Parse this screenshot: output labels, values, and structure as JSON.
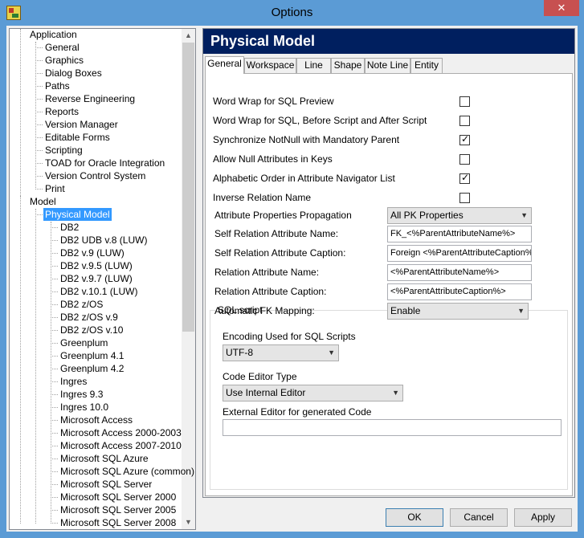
{
  "window": {
    "title": "Options",
    "close_glyph": "✕"
  },
  "tree": {
    "nodes": [
      {
        "label": "Application",
        "selected": false
      },
      {
        "label": "General",
        "selected": false
      },
      {
        "label": "Graphics",
        "selected": false
      },
      {
        "label": "Dialog Boxes",
        "selected": false
      },
      {
        "label": "Paths",
        "selected": false
      },
      {
        "label": "Reverse Engineering",
        "selected": false
      },
      {
        "label": "Reports",
        "selected": false
      },
      {
        "label": "Version Manager",
        "selected": false
      },
      {
        "label": "Editable Forms",
        "selected": false
      },
      {
        "label": "Scripting",
        "selected": false
      },
      {
        "label": "TOAD for Oracle Integration",
        "selected": false
      },
      {
        "label": "Version Control System",
        "selected": false
      },
      {
        "label": "Print",
        "selected": false
      },
      {
        "label": "Model",
        "selected": false
      },
      {
        "label": "Physical Model",
        "selected": true
      },
      {
        "label": "DB2",
        "selected": false
      },
      {
        "label": "DB2 UDB v.8 (LUW)",
        "selected": false
      },
      {
        "label": "DB2 v.9 (LUW)",
        "selected": false
      },
      {
        "label": "DB2 v.9.5 (LUW)",
        "selected": false
      },
      {
        "label": "DB2 v.9.7 (LUW)",
        "selected": false
      },
      {
        "label": "DB2 v.10.1 (LUW)",
        "selected": false
      },
      {
        "label": "DB2 z/OS",
        "selected": false
      },
      {
        "label": "DB2 z/OS v.9",
        "selected": false
      },
      {
        "label": "DB2 z/OS v.10",
        "selected": false
      },
      {
        "label": "Greenplum",
        "selected": false
      },
      {
        "label": "Greenplum 4.1",
        "selected": false
      },
      {
        "label": "Greenplum 4.2",
        "selected": false
      },
      {
        "label": "Ingres",
        "selected": false
      },
      {
        "label": "Ingres 9.3",
        "selected": false
      },
      {
        "label": "Ingres 10.0",
        "selected": false
      },
      {
        "label": "Microsoft Access",
        "selected": false
      },
      {
        "label": "Microsoft Access 2000-2003",
        "selected": false
      },
      {
        "label": "Microsoft Access 2007-2010",
        "selected": false
      },
      {
        "label": "Microsoft SQL Azure",
        "selected": false
      },
      {
        "label": "Microsoft SQL Azure (common)",
        "selected": false
      },
      {
        "label": "Microsoft SQL Server",
        "selected": false
      },
      {
        "label": "Microsoft SQL Server 2000",
        "selected": false
      },
      {
        "label": "Microsoft SQL Server 2005",
        "selected": false
      },
      {
        "label": "Microsoft SQL Server 2008",
        "selected": false
      }
    ],
    "scroll_up_glyph": "▲",
    "scroll_down_glyph": "▼"
  },
  "panel": {
    "header": "Physical Model",
    "tabs": [
      {
        "label": "General",
        "active": true
      },
      {
        "label": "Workspace",
        "active": false
      },
      {
        "label": "Line",
        "active": false
      },
      {
        "label": "Shape",
        "active": false
      },
      {
        "label": "Note Line",
        "active": false
      },
      {
        "label": "Entity",
        "active": false
      }
    ],
    "checkboxes": [
      {
        "label": "Word Wrap for SQL Preview",
        "checked": false
      },
      {
        "label": "Word Wrap for SQL, Before Script and After Script",
        "checked": false
      },
      {
        "label": "Synchronize NotNull with Mandatory Parent",
        "checked": true
      },
      {
        "label": "Allow Null Attributes in Keys",
        "checked": false
      },
      {
        "label": "Alphabetic Order in Attribute Navigator List",
        "checked": true
      },
      {
        "label": "Inverse Relation Name",
        "checked": false
      }
    ],
    "fields": [
      {
        "label": "Attribute Properties Propagation",
        "value": "All PK Properties",
        "kind": "combo"
      },
      {
        "label": "Self Relation Attribute Name:",
        "value": "FK_<%ParentAttributeName%>",
        "kind": "text"
      },
      {
        "label": "Self Relation Attribute Caption:",
        "value": "Foreign <%ParentAttributeCaption%>",
        "kind": "text"
      },
      {
        "label": "Relation Attribute Name:",
        "value": "<%ParentAttributeName%>",
        "kind": "text"
      },
      {
        "label": "Relation Attribute Caption:",
        "value": "<%ParentAttributeCaption%>",
        "kind": "text"
      },
      {
        "label": "Automatic FK Mapping:",
        "value": "Enable",
        "kind": "combo"
      }
    ],
    "sql_script": {
      "title": "SQL script",
      "encoding_label": "Encoding Used for SQL Scripts",
      "encoding_value": "UTF-8",
      "editor_type_label": "Code Editor Type",
      "editor_type_value": "Use Internal Editor",
      "external_editor_label": "External Editor for generated Code",
      "external_editor_value": ""
    }
  },
  "buttons": {
    "ok": "OK",
    "cancel": "Cancel",
    "apply": "Apply"
  },
  "dropdown_glyph": "▼"
}
